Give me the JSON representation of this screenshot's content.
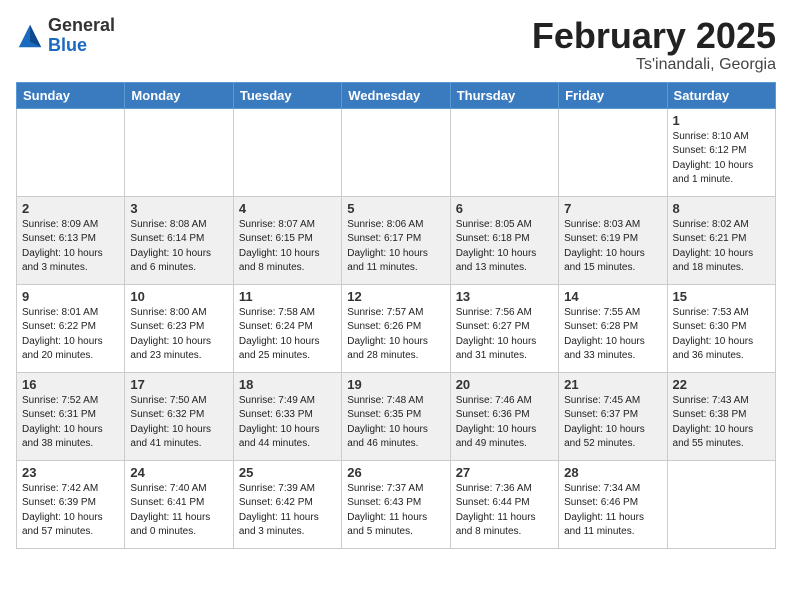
{
  "header": {
    "logo_general": "General",
    "logo_blue": "Blue",
    "cal_title": "February 2025",
    "cal_subtitle": "Ts'inandali, Georgia"
  },
  "weekdays": [
    "Sunday",
    "Monday",
    "Tuesday",
    "Wednesday",
    "Thursday",
    "Friday",
    "Saturday"
  ],
  "weeks": [
    [
      {
        "day": "",
        "info": ""
      },
      {
        "day": "",
        "info": ""
      },
      {
        "day": "",
        "info": ""
      },
      {
        "day": "",
        "info": ""
      },
      {
        "day": "",
        "info": ""
      },
      {
        "day": "",
        "info": ""
      },
      {
        "day": "1",
        "info": "Sunrise: 8:10 AM\nSunset: 6:12 PM\nDaylight: 10 hours\nand 1 minute."
      }
    ],
    [
      {
        "day": "2",
        "info": "Sunrise: 8:09 AM\nSunset: 6:13 PM\nDaylight: 10 hours\nand 3 minutes."
      },
      {
        "day": "3",
        "info": "Sunrise: 8:08 AM\nSunset: 6:14 PM\nDaylight: 10 hours\nand 6 minutes."
      },
      {
        "day": "4",
        "info": "Sunrise: 8:07 AM\nSunset: 6:15 PM\nDaylight: 10 hours\nand 8 minutes."
      },
      {
        "day": "5",
        "info": "Sunrise: 8:06 AM\nSunset: 6:17 PM\nDaylight: 10 hours\nand 11 minutes."
      },
      {
        "day": "6",
        "info": "Sunrise: 8:05 AM\nSunset: 6:18 PM\nDaylight: 10 hours\nand 13 minutes."
      },
      {
        "day": "7",
        "info": "Sunrise: 8:03 AM\nSunset: 6:19 PM\nDaylight: 10 hours\nand 15 minutes."
      },
      {
        "day": "8",
        "info": "Sunrise: 8:02 AM\nSunset: 6:21 PM\nDaylight: 10 hours\nand 18 minutes."
      }
    ],
    [
      {
        "day": "9",
        "info": "Sunrise: 8:01 AM\nSunset: 6:22 PM\nDaylight: 10 hours\nand 20 minutes."
      },
      {
        "day": "10",
        "info": "Sunrise: 8:00 AM\nSunset: 6:23 PM\nDaylight: 10 hours\nand 23 minutes."
      },
      {
        "day": "11",
        "info": "Sunrise: 7:58 AM\nSunset: 6:24 PM\nDaylight: 10 hours\nand 25 minutes."
      },
      {
        "day": "12",
        "info": "Sunrise: 7:57 AM\nSunset: 6:26 PM\nDaylight: 10 hours\nand 28 minutes."
      },
      {
        "day": "13",
        "info": "Sunrise: 7:56 AM\nSunset: 6:27 PM\nDaylight: 10 hours\nand 31 minutes."
      },
      {
        "day": "14",
        "info": "Sunrise: 7:55 AM\nSunset: 6:28 PM\nDaylight: 10 hours\nand 33 minutes."
      },
      {
        "day": "15",
        "info": "Sunrise: 7:53 AM\nSunset: 6:30 PM\nDaylight: 10 hours\nand 36 minutes."
      }
    ],
    [
      {
        "day": "16",
        "info": "Sunrise: 7:52 AM\nSunset: 6:31 PM\nDaylight: 10 hours\nand 38 minutes."
      },
      {
        "day": "17",
        "info": "Sunrise: 7:50 AM\nSunset: 6:32 PM\nDaylight: 10 hours\nand 41 minutes."
      },
      {
        "day": "18",
        "info": "Sunrise: 7:49 AM\nSunset: 6:33 PM\nDaylight: 10 hours\nand 44 minutes."
      },
      {
        "day": "19",
        "info": "Sunrise: 7:48 AM\nSunset: 6:35 PM\nDaylight: 10 hours\nand 46 minutes."
      },
      {
        "day": "20",
        "info": "Sunrise: 7:46 AM\nSunset: 6:36 PM\nDaylight: 10 hours\nand 49 minutes."
      },
      {
        "day": "21",
        "info": "Sunrise: 7:45 AM\nSunset: 6:37 PM\nDaylight: 10 hours\nand 52 minutes."
      },
      {
        "day": "22",
        "info": "Sunrise: 7:43 AM\nSunset: 6:38 PM\nDaylight: 10 hours\nand 55 minutes."
      }
    ],
    [
      {
        "day": "23",
        "info": "Sunrise: 7:42 AM\nSunset: 6:39 PM\nDaylight: 10 hours\nand 57 minutes."
      },
      {
        "day": "24",
        "info": "Sunrise: 7:40 AM\nSunset: 6:41 PM\nDaylight: 11 hours\nand 0 minutes."
      },
      {
        "day": "25",
        "info": "Sunrise: 7:39 AM\nSunset: 6:42 PM\nDaylight: 11 hours\nand 3 minutes."
      },
      {
        "day": "26",
        "info": "Sunrise: 7:37 AM\nSunset: 6:43 PM\nDaylight: 11 hours\nand 5 minutes."
      },
      {
        "day": "27",
        "info": "Sunrise: 7:36 AM\nSunset: 6:44 PM\nDaylight: 11 hours\nand 8 minutes."
      },
      {
        "day": "28",
        "info": "Sunrise: 7:34 AM\nSunset: 6:46 PM\nDaylight: 11 hours\nand 11 minutes."
      },
      {
        "day": "",
        "info": ""
      }
    ]
  ]
}
